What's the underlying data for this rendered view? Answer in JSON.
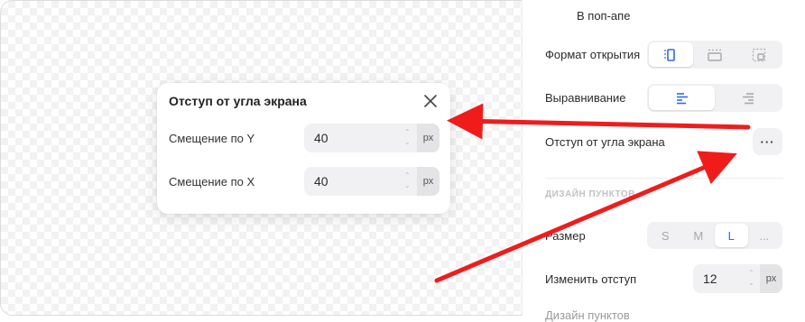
{
  "panel": {
    "inpopup_label": "В поп-апе",
    "open_format": {
      "label": "Формат открытия",
      "options": [
        "sidebar-layout-icon",
        "topbar-layout-icon",
        "corner-layout-icon"
      ],
      "selected": 0
    },
    "alignment": {
      "label": "Выравнивание",
      "options": [
        "align-left-icon",
        "align-right-icon"
      ],
      "selected": 0
    },
    "corner_offset": {
      "label": "Отступ от угла экрана",
      "button_label": "···"
    },
    "section_title": "ДИЗАЙН ПУНКТОВ",
    "size": {
      "label": "Размер",
      "options": [
        "S",
        "M",
        "L",
        "..."
      ],
      "selected": "L"
    },
    "change_offset": {
      "label": "Изменить отступ",
      "value": "12",
      "unit": "px"
    },
    "partial_next_label": "Дизайн пунктов"
  },
  "popup": {
    "title": "Отступ от угла экрана",
    "fields": [
      {
        "label": "Смещение по Y",
        "value": "40",
        "unit": "px"
      },
      {
        "label": "Смещение по X",
        "value": "40",
        "unit": "px"
      }
    ]
  },
  "annotations": {
    "arrow_color": "#f01c1c"
  },
  "colors": {
    "accent": "#2f6de0",
    "segment_bg": "#f1f1f3"
  }
}
